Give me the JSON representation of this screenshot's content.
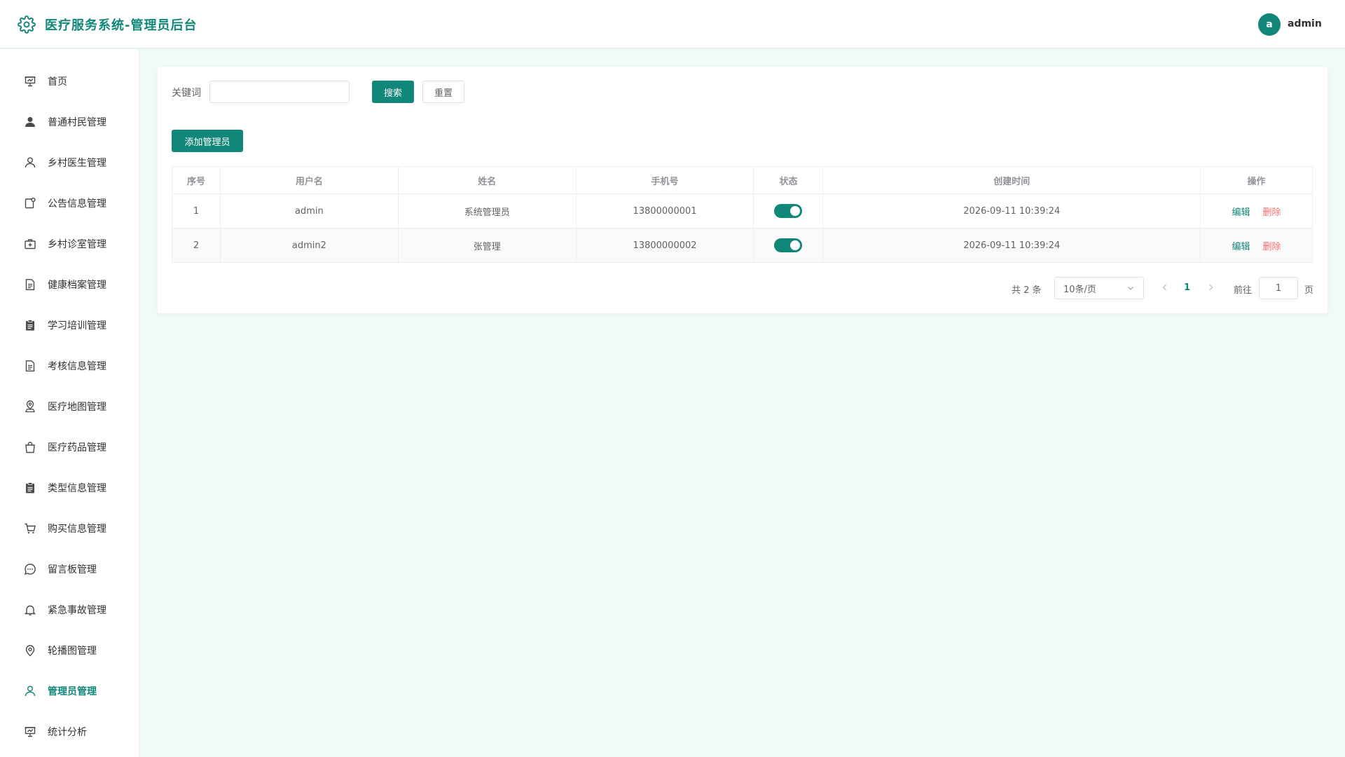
{
  "header": {
    "title": "医疗服务系统-管理员后台",
    "avatar_letter": "a",
    "user_name": "admin"
  },
  "sidebar": {
    "items": [
      {
        "label": "首页",
        "icon": "chart-board-icon"
      },
      {
        "label": "普通村民管理",
        "icon": "user-filled-icon"
      },
      {
        "label": "乡村医生管理",
        "icon": "user-icon"
      },
      {
        "label": "公告信息管理",
        "icon": "notice-icon"
      },
      {
        "label": "乡村诊室管理",
        "icon": "first-aid-kit-icon"
      },
      {
        "label": "健康档案管理",
        "icon": "document-icon"
      },
      {
        "label": "学习培训管理",
        "icon": "clipboard-icon"
      },
      {
        "label": "考核信息管理",
        "icon": "document-icon"
      },
      {
        "label": "医疗地图管理",
        "icon": "map-location-icon"
      },
      {
        "label": "医疗药品管理",
        "icon": "shopping-bag-icon"
      },
      {
        "label": "类型信息管理",
        "icon": "clipboard-icon"
      },
      {
        "label": "购买信息管理",
        "icon": "shopping-cart-icon"
      },
      {
        "label": "留言板管理",
        "icon": "chat-dot-icon"
      },
      {
        "label": "紧急事故管理",
        "icon": "bell-icon"
      },
      {
        "label": "轮播图管理",
        "icon": "location-pin-icon"
      },
      {
        "label": "管理员管理",
        "icon": "user-icon",
        "active": true
      },
      {
        "label": "统计分析",
        "icon": "chart-board-icon"
      }
    ]
  },
  "search": {
    "label": "关键词",
    "value": "",
    "placeholder": "",
    "search_button": "搜索",
    "reset_button": "重置"
  },
  "add_button": "添加管理员",
  "table": {
    "headers": [
      "序号",
      "用户名",
      "姓名",
      "手机号",
      "状态",
      "创建时间",
      "操作"
    ],
    "rows": [
      {
        "index": "1",
        "username": "admin",
        "name": "系统管理员",
        "phone": "13800000001",
        "status_on": true,
        "created": "2026-09-11 10:39:24"
      },
      {
        "index": "2",
        "username": "admin2",
        "name": "张管理",
        "phone": "13800000002",
        "status_on": true,
        "created": "2026-09-11 10:39:24"
      }
    ],
    "edit_label": "编辑",
    "delete_label": "删除"
  },
  "pagination": {
    "total_text": "共 2 条",
    "page_size": "10条/页",
    "current_page": "1",
    "goto_label": "前往",
    "goto_value": "1",
    "page_label": "页"
  },
  "colors": {
    "primary": "#11877a",
    "danger": "#f56c6c",
    "background": "#f0fbf9"
  }
}
